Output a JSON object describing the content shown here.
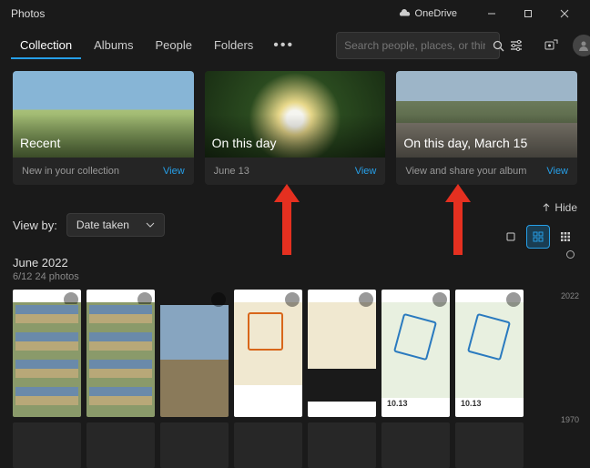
{
  "title": "Photos",
  "onedrive": "OneDrive",
  "nav": {
    "items": [
      "Collection",
      "Albums",
      "People",
      "Folders"
    ],
    "search_placeholder": "Search people, places, or things..."
  },
  "cards": [
    {
      "title": "Recent",
      "subtitle": "New in your collection",
      "action": "View"
    },
    {
      "title": "On this day",
      "subtitle": "June 13",
      "action": "View"
    },
    {
      "title": "On this day, March 15",
      "subtitle": "View and share your album",
      "action": "View"
    }
  ],
  "viewby": {
    "label": "View by:",
    "value": "Date taken",
    "hide": "Hide"
  },
  "section": {
    "month": "June 2022",
    "count": "6/12   24 photos"
  },
  "timeline": {
    "years": [
      "2022",
      "1970"
    ]
  }
}
